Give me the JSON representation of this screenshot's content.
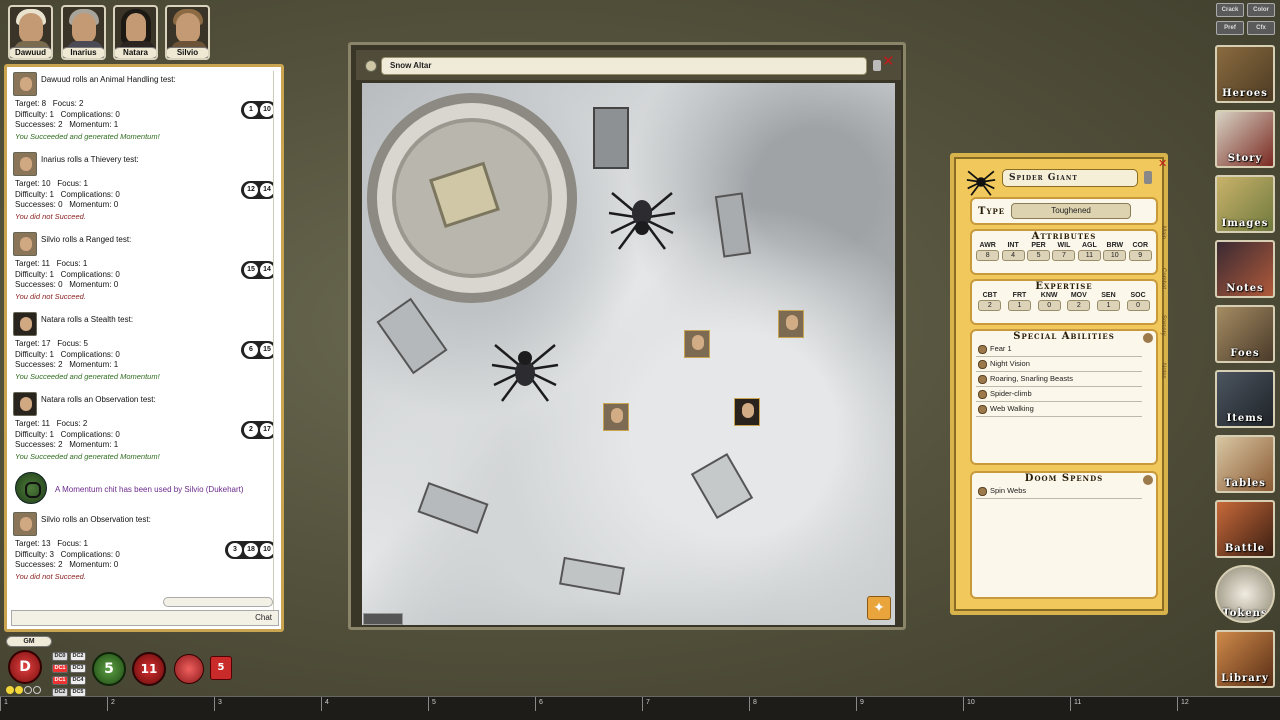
{
  "party": [
    {
      "name": "Dawuud"
    },
    {
      "name": "Inarius"
    },
    {
      "name": "Natara"
    },
    {
      "name": "Silvio"
    }
  ],
  "chat": {
    "entries": [
      {
        "title": "Dawuud rolls an Animal Handling test:",
        "stats": "Target: 8   Focus: 2\nDifficulty: 1   Complications: 0\nSuccesses: 2   Momentum: 1",
        "result": "You Succeeded and generated Momentum!",
        "result_ok": true,
        "dice": [
          "1",
          "10"
        ]
      },
      {
        "title": "Inarius rolls a Thievery test:",
        "stats": "Target: 10   Focus: 1\nDifficulty: 1   Complications: 0\nSuccesses: 0   Momentum: 0",
        "result": "You did not Succeed.",
        "result_ok": false,
        "dice": [
          "12",
          "14"
        ]
      },
      {
        "title": "Silvio rolls a Ranged test:",
        "stats": "Target: 11   Focus: 1\nDifficulty: 1   Complications: 0\nSuccesses: 0   Momentum: 0",
        "result": "You did not Succeed.",
        "result_ok": false,
        "dice": [
          "15",
          "14"
        ]
      },
      {
        "title": "Natara rolls a Stealth test:",
        "stats": "Target: 17   Focus: 5\nDifficulty: 1   Complications: 0\nSuccesses: 2   Momentum: 1",
        "result": "You Succeeded and generated Momentum!",
        "result_ok": true,
        "dice": [
          "6",
          "15"
        ]
      },
      {
        "title": "Natara rolls an Observation test:",
        "stats": "Target: 11   Focus: 2\nDifficulty: 1   Complications: 0\nSuccesses: 2   Momentum: 1",
        "result": "You Succeeded and generated Momentum!",
        "result_ok": true,
        "dice": [
          "2",
          "17"
        ]
      }
    ],
    "momentum_msg": "A Momentum chit has been used by Silvio (Dukehart)",
    "last": {
      "title": "Silvio rolls an Observation test:",
      "stats": "Target: 13   Focus: 1\nDifficulty: 3   Complications: 0\nSuccesses: 2   Momentum: 0",
      "result": "You did not Succeed.",
      "dice": [
        "3",
        "18",
        "10"
      ]
    },
    "input_label": "Chat"
  },
  "map": {
    "title": "Snow Altar"
  },
  "npc": {
    "name": "Spider Giant",
    "type_label": "Type",
    "type_value": "Toughened",
    "attributes_title": "Attributes",
    "attributes": [
      {
        "k": "AWR",
        "v": "8"
      },
      {
        "k": "INT",
        "v": "4"
      },
      {
        "k": "PER",
        "v": "5"
      },
      {
        "k": "WIL",
        "v": "7"
      },
      {
        "k": "AGL",
        "v": "11"
      },
      {
        "k": "BRW",
        "v": "10"
      },
      {
        "k": "COR",
        "v": "9"
      }
    ],
    "expertise_title": "Expertise",
    "expertise": [
      {
        "k": "CBT",
        "v": "2"
      },
      {
        "k": "FRT",
        "v": "1"
      },
      {
        "k": "KNW",
        "v": "0"
      },
      {
        "k": "MOV",
        "v": "2"
      },
      {
        "k": "SEN",
        "v": "1"
      },
      {
        "k": "SOC",
        "v": "0"
      }
    ],
    "abilities_title": "Special Abilities",
    "abilities": [
      "Fear 1",
      "Night Vision",
      "Roaring, Snarling Beasts",
      "Spider-climb",
      "Web Walking"
    ],
    "doom_title": "Doom Spends",
    "doom": [
      "Spin Webs"
    ],
    "tabs": [
      "Main",
      "Combat",
      "Sorcery",
      "Notes"
    ]
  },
  "sidebar": [
    "Heroes",
    "Story",
    "Images",
    "Notes",
    "Foes",
    "Items",
    "Tables",
    "Battle",
    "Tokens",
    "Library"
  ],
  "top_buttons": [
    "Crack",
    "Color",
    "Pref",
    "Cfx"
  ],
  "hotbar": {
    "gm_label": "GM",
    "d_label": "D",
    "momentum": "5",
    "doom": "11",
    "pool": "5",
    "dc": [
      "DC0",
      "DC2",
      "DC1",
      "DC3",
      "DC1",
      "DC4",
      "DC2",
      "DC5"
    ]
  },
  "ruler": [
    "1",
    "2",
    "3",
    "4",
    "5",
    "6",
    "7",
    "8",
    "9",
    "10",
    "11",
    "12"
  ]
}
